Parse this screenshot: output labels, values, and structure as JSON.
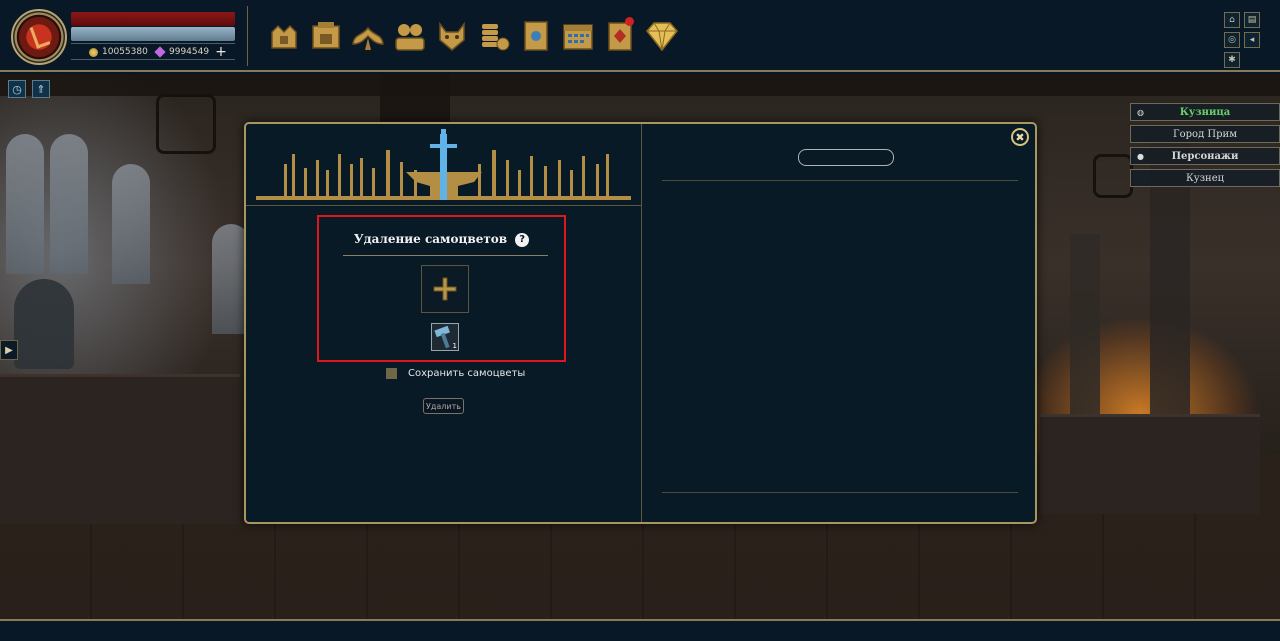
{
  "player": {
    "gold": "10055380",
    "gems": "9994549",
    "add_label": "+"
  },
  "nav_icons": [
    "rucksack-icon",
    "shop-icon",
    "wings-icon",
    "friends-icon",
    "wolf-mask-icon",
    "coins-icon",
    "spellbook-icon",
    "calendar-icon",
    "card-icon",
    "diamond-icon"
  ],
  "system_buttons": [
    "home-icon",
    "chat-icon",
    "settings-circle-icon",
    "sound-icon",
    "gear-icon"
  ],
  "right_menu": {
    "location_header": "Кузница",
    "location_sub": "Город Прим",
    "characters_header": "Персонажи",
    "character_name": "Кузнец"
  },
  "modal": {
    "title": "Удаление самоцветов",
    "help_label": "?",
    "item_count": "1",
    "keep_gems_label": "Сохранить самоцветы",
    "delete_button": "Удалить",
    "close_label": "✖"
  },
  "colors": {
    "accent_gold": "#a8965f",
    "highlight_red": "#e0161a",
    "active_green": "#6bd06b",
    "panel_bg": "#081a26"
  }
}
